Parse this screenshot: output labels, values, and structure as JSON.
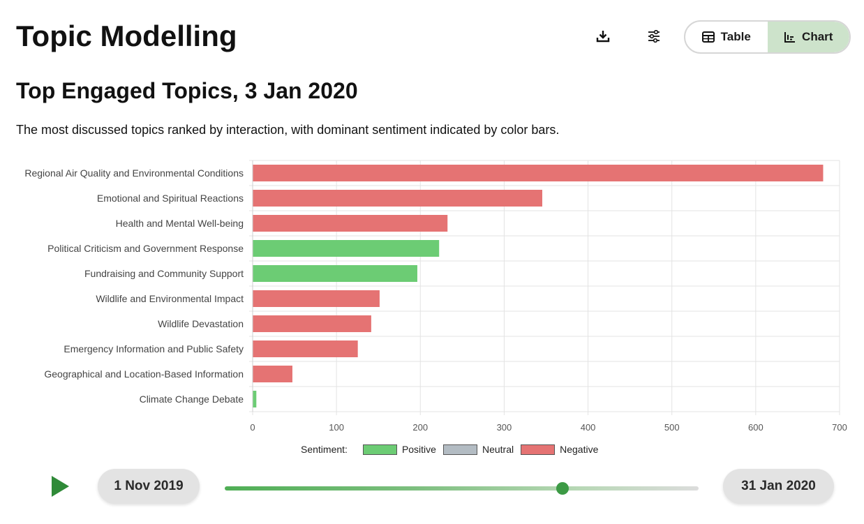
{
  "header": {
    "title": "Topic Modelling",
    "download_icon": "download-icon",
    "settings_icon": "sliders-icon",
    "view_toggle": {
      "table_label": "Table",
      "chart_label": "Chart",
      "active": "Chart"
    }
  },
  "chart_header": {
    "title": "Top Engaged Topics, 3 Jan 2020",
    "subtitle": "The most discussed topics ranked by interaction, with dominant sentiment indicated by color bars."
  },
  "legend": {
    "label": "Sentiment:",
    "items": [
      {
        "name": "Positive",
        "color": "#6ccc74"
      },
      {
        "name": "Neutral",
        "color": "#b3bcc3"
      },
      {
        "name": "Negative",
        "color": "#e57373"
      }
    ]
  },
  "chart_data": {
    "type": "bar",
    "orientation": "horizontal",
    "categories": [
      "Regional Air Quality and Environmental Conditions",
      "Emotional and Spiritual Reactions",
      "Health and Mental Well-being",
      "Political Criticism and Government Response",
      "Fundraising and Community Support",
      "Wildlife and Environmental Impact",
      "Wildlife Devastation",
      "Emergency Information and Public Safety",
      "Geographical and Location-Based Information",
      "Climate Change Debate"
    ],
    "values": [
      680,
      345,
      232,
      222,
      196,
      151,
      141,
      125,
      47,
      4
    ],
    "sentiment": [
      "Negative",
      "Negative",
      "Negative",
      "Positive",
      "Positive",
      "Negative",
      "Negative",
      "Negative",
      "Negative",
      "Positive"
    ],
    "xlim": [
      0,
      700
    ],
    "xticks": [
      "0",
      "100",
      "200",
      "300",
      "400",
      "500",
      "600",
      "700"
    ],
    "grid": true
  },
  "timeline": {
    "play_icon": "play-icon",
    "start_label": "1 Nov 2019",
    "end_label": "31 Jan 2020",
    "position": 0.71
  }
}
